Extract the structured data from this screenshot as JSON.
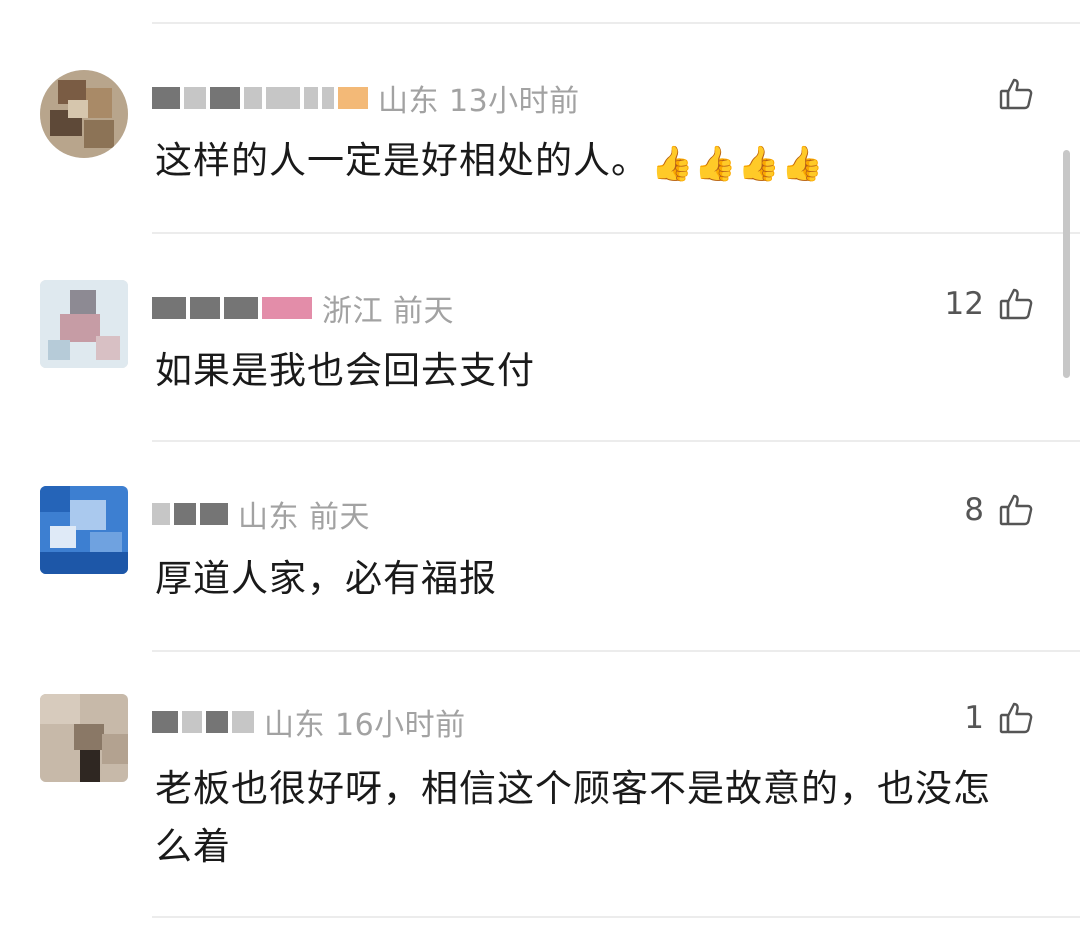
{
  "comments": [
    {
      "location": "山东",
      "time": "13小时前",
      "text": "这样的人一定是好相处的人。",
      "emoji": "👍👍👍👍",
      "likes": ""
    },
    {
      "location": "浙江",
      "time": "前天",
      "text": "如果是我也会回去支付",
      "emoji": "",
      "likes": "12"
    },
    {
      "location": "山东",
      "time": "前天",
      "text": "厚道人家，必有福报",
      "emoji": "",
      "likes": "8"
    },
    {
      "location": "山东",
      "time": "16小时前",
      "text": "老板也很好呀，相信这个顾客不是故意的，也没怎么着",
      "emoji": "",
      "likes": "1"
    }
  ],
  "icons": {
    "like": "thumbs-up-outline-icon",
    "emoji": "thumbs-up-emoji"
  }
}
